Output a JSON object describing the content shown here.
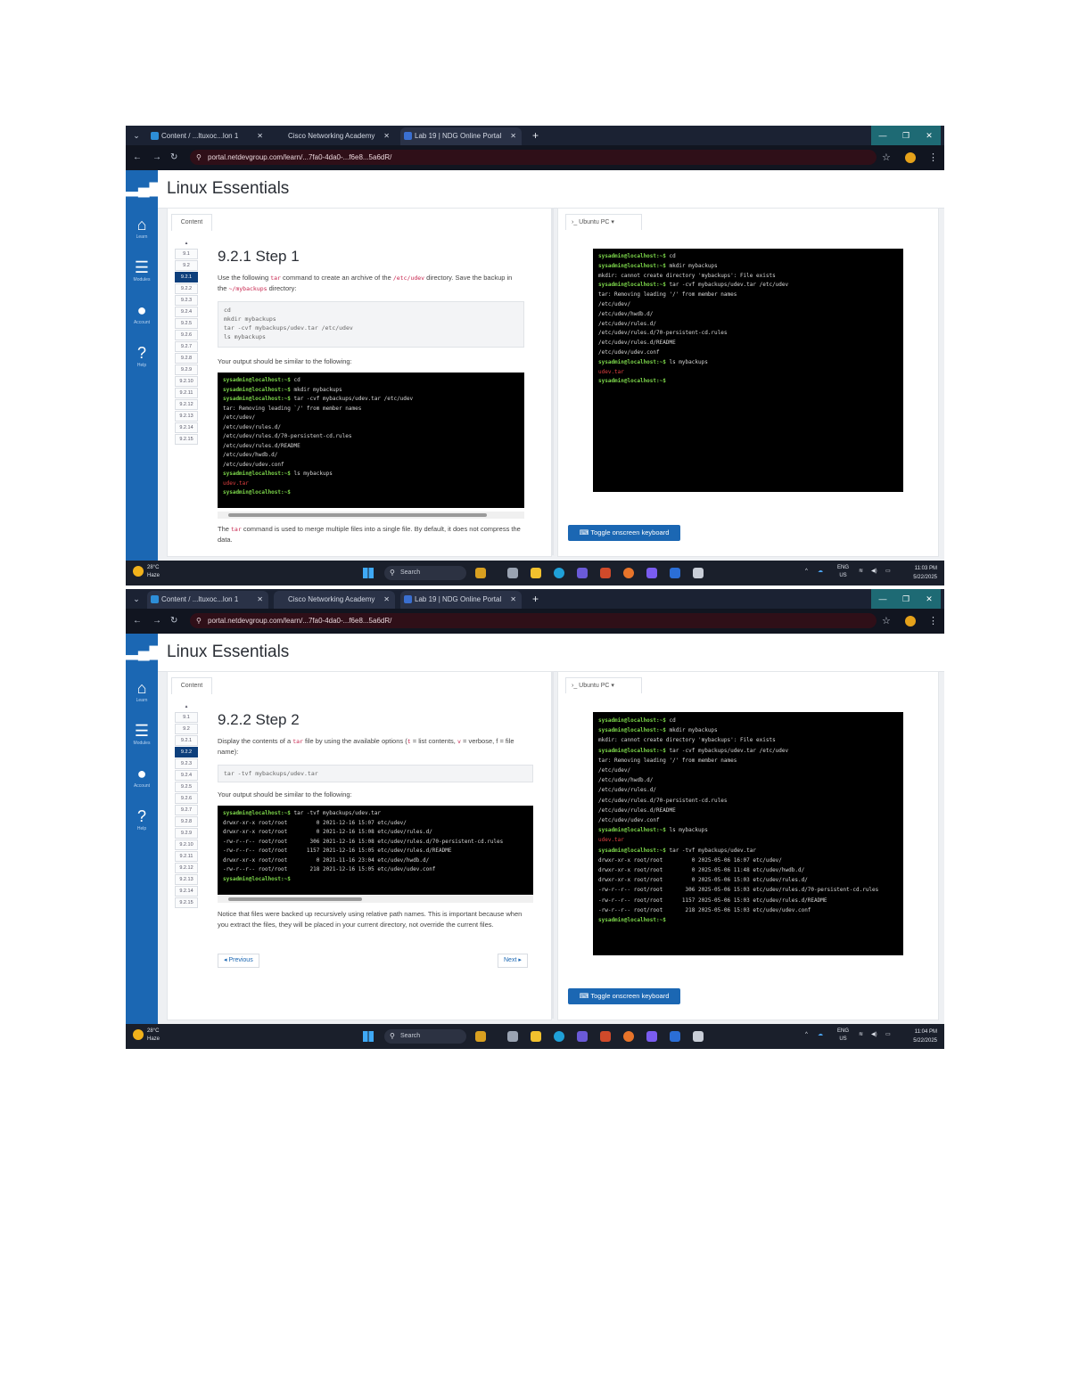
{
  "shots": [
    {
      "tabs": [
        {
          "label": "Content / ...ltuxoc...lon 1"
        },
        {
          "label": "Cisco Networking Academy"
        },
        {
          "label": "Lab 19 | NDG Online Portal"
        }
      ],
      "url": "portal.netdevgroup.com/learn/...7fa0-4da0-...f6e8...5a6dR/",
      "app_title": "Linux Essentials",
      "sidebar": [
        {
          "icon": "⌂",
          "label": "Learn"
        },
        {
          "icon": "☰",
          "label": "Modules"
        },
        {
          "icon": "●",
          "label": "Account"
        },
        {
          "icon": "?",
          "label": "Help"
        }
      ],
      "content_tab": "Content",
      "toc": [
        "9.1",
        "9.2",
        "9.2.1",
        "9.2.2",
        "9.2.3",
        "9.2.4",
        "9.2.5",
        "9.2.6",
        "9.2.7",
        "9.2.8",
        "9.2.9",
        "9.2.10",
        "9.2.11",
        "9.2.12",
        "9.2.13",
        "9.2.14",
        "9.2.15"
      ],
      "step_title": "9.2.1 Step 1",
      "instruction_a": "Use the following ",
      "instruction_code": "tar",
      "instruction_b": " command to create an archive of the ",
      "instruction_code2": "/etc/udev",
      "instruction_c": " directory. Save the backup in the ",
      "instruction_code3": "~/mybackups",
      "instruction_d": " directory:",
      "command_lines": [
        "cd",
        "mkdir mybackups",
        "tar -cvf mybackups/udev.tar /etc/udev",
        "ls mybackups"
      ],
      "output_label": "Your output should be similar to the following:",
      "prompt": "sysadmin@localhost:~$",
      "terminal_lines": [
        {
          "cmd": " cd"
        },
        {
          "cmd": " mkdir mybackups"
        },
        {
          "cmd": " tar -cvf mybackups/udev.tar /etc/udev"
        },
        {
          "out": "tar: Removing leading `/' from member names"
        },
        {
          "out": "/etc/udev/"
        },
        {
          "out": "/etc/udev/rules.d/"
        },
        {
          "out": "/etc/udev/rules.d/70-persistent-cd.rules"
        },
        {
          "out": "/etc/udev/rules.d/README"
        },
        {
          "out": "/etc/udev/hwdb.d/"
        },
        {
          "out": "/etc/udev/udev.conf"
        },
        {
          "cmd": " ls mybackups"
        },
        {
          "red": "udev.tar"
        },
        {
          "cmd": ""
        }
      ],
      "footnote_a": "The ",
      "footnote_code": "tar",
      "footnote_b": " command is used to merge multiple files into a single file. By default, it does not compress the data.",
      "vm_tab": "Ubuntu PC",
      "vm_lines": [
        {
          "cmd": " cd"
        },
        {
          "cmd": " mkdir mybackups"
        },
        {
          "out": "mkdir: cannot create directory 'mybackups': File exists"
        },
        {
          "cmd": " tar -cvf mybackups/udev.tar /etc/udev"
        },
        {
          "out": "tar: Removing leading '/' from member names"
        },
        {
          "out": "/etc/udev/"
        },
        {
          "out": "/etc/udev/hwdb.d/"
        },
        {
          "out": "/etc/udev/rules.d/"
        },
        {
          "out": "/etc/udev/rules.d/70-persistent-cd.rules"
        },
        {
          "out": "/etc/udev/rules.d/README"
        },
        {
          "out": "/etc/udev/udev.conf"
        },
        {
          "cmd": " ls mybackups"
        },
        {
          "red": "udev.tar"
        },
        {
          "cmd": ""
        }
      ],
      "keyboard_btn": "Toggle onscreen keyboard",
      "weather_temp": "28°C",
      "weather_desc": "Haze",
      "search": "Search",
      "lang": "ENG",
      "region": "US",
      "time": "11:03 PM",
      "date": "5/22/2025"
    },
    {
      "tabs": [
        {
          "label": "Content / ...ltuxoc...lon 1"
        },
        {
          "label": "Cisco Networking Academy"
        },
        {
          "label": "Lab 19 | NDG Online Portal"
        }
      ],
      "url": "portal.netdevgroup.com/learn/...7fa0-4da0-...f6e8...5a6dR/",
      "app_title": "Linux Essentials",
      "sidebar": [
        {
          "icon": "⌂",
          "label": "Learn"
        },
        {
          "icon": "☰",
          "label": "Modules"
        },
        {
          "icon": "●",
          "label": "Account"
        },
        {
          "icon": "?",
          "label": "Help"
        }
      ],
      "content_tab": "Content",
      "toc": [
        "9.1",
        "9.2",
        "9.2.1",
        "9.2.2",
        "9.2.3",
        "9.2.4",
        "9.2.5",
        "9.2.6",
        "9.2.7",
        "9.2.8",
        "9.2.9",
        "9.2.10",
        "9.2.11",
        "9.2.12",
        "9.2.13",
        "9.2.14",
        "9.2.15"
      ],
      "step_title": "9.2.2 Step 2",
      "instruction_a": "Display the contents of a ",
      "instruction_code": "tar",
      "instruction_b": " file by using the available options (",
      "instruction_code2": "t",
      "instruction_c": " = list contents, ",
      "instruction_code3": "v",
      "instruction_d": " = verbose, f = file name):",
      "command_lines": [
        "tar -tvf mybackups/udev.tar"
      ],
      "output_label": "Your output should be similar to the following:",
      "prompt": "sysadmin@localhost:~$",
      "terminal_lines": [
        {
          "cmd": " tar -tvf mybackups/udev.tar"
        },
        {
          "out": "drwxr-xr-x root/root         0 2021-12-16 15:07 etc/udev/"
        },
        {
          "out": "drwxr-xr-x root/root         0 2021-12-16 15:08 etc/udev/rules.d/"
        },
        {
          "out": "-rw-r--r-- root/root       306 2021-12-16 15:08 etc/udev/rules.d/70-persistent-cd.rules"
        },
        {
          "out": "-rw-r--r-- root/root      1157 2021-12-16 15:05 etc/udev/rules.d/README"
        },
        {
          "out": "drwxr-xr-x root/root         0 2021-11-16 23:04 etc/udev/hwdb.d/"
        },
        {
          "out": "-rw-r--r-- root/root       218 2021-12-16 15:05 etc/udev/udev.conf"
        },
        {
          "cmd": ""
        }
      ],
      "footnote_a": "Notice that files were backed up recursively using relative path names. This is important because when you extract the files, they will be placed in your current directory, not override the current files.",
      "footnote_code": "",
      "footnote_b": "",
      "prev_btn": "◂ Previous",
      "next_btn": "Next ▸",
      "vm_tab": "Ubuntu PC",
      "vm_lines": [
        {
          "cmd": " cd"
        },
        {
          "cmd": " mkdir mybackups"
        },
        {
          "out": "mkdir: cannot create directory 'mybackups': File exists"
        },
        {
          "cmd": " tar -cvf mybackups/udev.tar /etc/udev"
        },
        {
          "out": "tar: Removing leading '/' from member names"
        },
        {
          "out": "/etc/udev/"
        },
        {
          "out": "/etc/udev/hwdb.d/"
        },
        {
          "out": "/etc/udev/rules.d/"
        },
        {
          "out": "/etc/udev/rules.d/70-persistent-cd.rules"
        },
        {
          "out": "/etc/udev/rules.d/README"
        },
        {
          "out": "/etc/udev/udev.conf"
        },
        {
          "cmd": " ls mybackups"
        },
        {
          "red": "udev.tar"
        },
        {
          "cmd": " tar -tvf mybackups/udev.tar"
        },
        {
          "out": "drwxr-xr-x root/root         0 2025-05-06 16:07 etc/udev/"
        },
        {
          "out": "drwxr-xr-x root/root         0 2025-05-06 11:48 etc/udev/hwdb.d/"
        },
        {
          "out": "drwxr-xr-x root/root         0 2025-05-06 15:03 etc/udev/rules.d/"
        },
        {
          "out": "-rw-r--r-- root/root       306 2025-05-06 15:03 etc/udev/rules.d/70-persistent-cd.rules"
        },
        {
          "out": "-rw-r--r-- root/root      1157 2025-05-06 15:03 etc/udev/rules.d/README"
        },
        {
          "out": "-rw-r--r-- root/root       218 2025-05-06 15:03 etc/udev/udev.conf"
        },
        {
          "cmd": ""
        }
      ],
      "keyboard_btn": "Toggle onscreen keyboard",
      "weather_temp": "28°C",
      "weather_desc": "Haze",
      "search": "Search",
      "lang": "ENG",
      "region": "US",
      "time": "11:04 PM",
      "date": "5/22/2025"
    }
  ]
}
